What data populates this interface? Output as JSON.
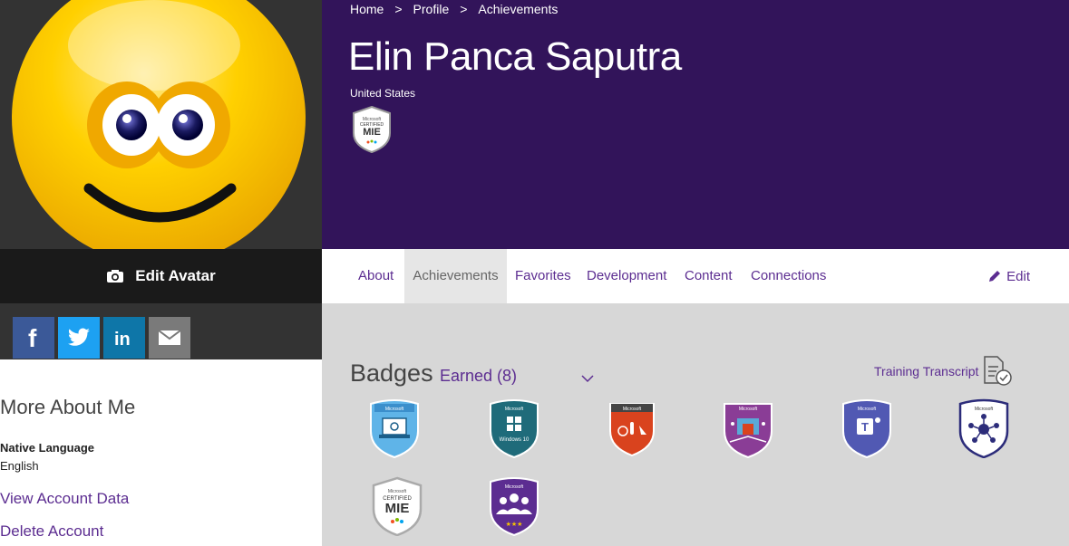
{
  "breadcrumb": [
    "Home",
    "Profile",
    "Achievements"
  ],
  "profile": {
    "name": "Elin Panca Saputra",
    "country": "United States"
  },
  "avatar": {
    "edit_label": "Edit Avatar"
  },
  "social": [
    {
      "id": "facebook",
      "icon": "facebook-icon",
      "color": "#3b5998"
    },
    {
      "id": "twitter",
      "icon": "twitter-icon",
      "color": "#1da1f2"
    },
    {
      "id": "linkedin",
      "icon": "linkedin-icon",
      "color": "#0e76a8"
    },
    {
      "id": "email",
      "icon": "mail-icon",
      "color": "#666666"
    }
  ],
  "tabs": [
    "About",
    "Achievements",
    "Favorites",
    "Development",
    "Content",
    "Connections"
  ],
  "active_tab": "Achievements",
  "edit_label": "Edit",
  "about_me": {
    "heading": "More About Me",
    "native_language_label": "Native Language",
    "native_language_value": "English",
    "view_account": "View Account Data",
    "delete_account": "Delete Account"
  },
  "badges": {
    "title": "Badges",
    "filter": "Earned (8)",
    "transcript": "Training Transcript",
    "items": [
      {
        "name": "badge-blue-laptop",
        "icon": "laptop-icon",
        "color": "#5fb4e8"
      },
      {
        "name": "badge-windows10",
        "icon": "windows-icon",
        "color": "#1f6b7a",
        "label": "Windows 10"
      },
      {
        "name": "badge-office-red",
        "icon": "mic-icon",
        "color": "#d9431e"
      },
      {
        "name": "badge-purple-class",
        "icon": "classroom-icon",
        "color": "#8a3d96"
      },
      {
        "name": "badge-teams",
        "icon": "teams-icon",
        "color": "#5159b3"
      },
      {
        "name": "badge-community",
        "icon": "network-icon",
        "color": "#ffffff"
      },
      {
        "name": "badge-mie",
        "icon": "mie-icon",
        "color": "#ffffff"
      },
      {
        "name": "badge-group",
        "icon": "group-icon",
        "color": "#5c2d91"
      }
    ]
  },
  "colors": {
    "header_bg": "#32145a",
    "accent": "#5c2d91",
    "avatar_face": "#f5c400"
  }
}
